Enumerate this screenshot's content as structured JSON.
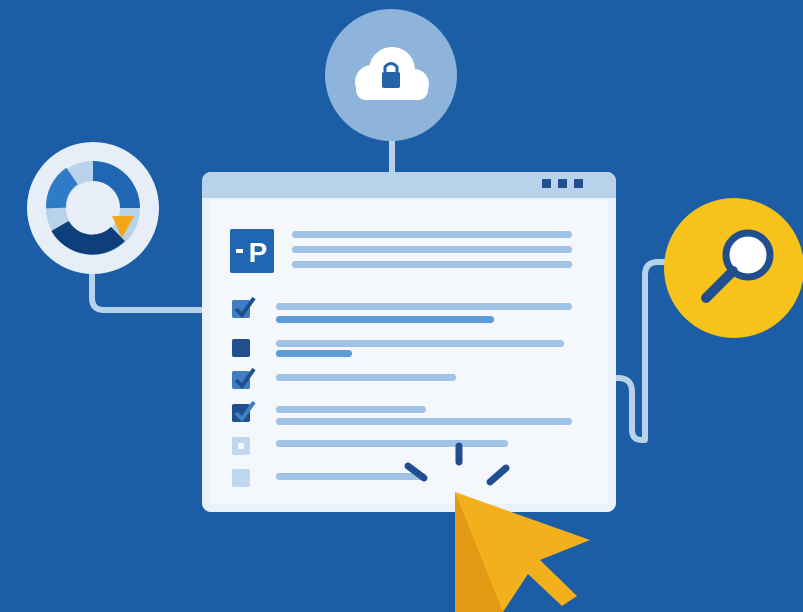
{
  "colors": {
    "background": "#1b5ea5",
    "window_frame": "#e9f1fb",
    "window_body": "#f4f8fd",
    "titlebar": "#b9d2ec",
    "line_light": "#9fc2e6",
    "line_mid": "#5f9bd6",
    "logo_tile": "#1f66b3",
    "checkbox": "#3f7ec3",
    "checkbox_empty": "#bfd7ef",
    "cloud_badge": "#8fb4dc",
    "chart_badge": "#e7eef8",
    "search_badge": "#f7c21a",
    "cursor": "#f2b01c",
    "connector": "#b9d2ec"
  },
  "icons": {
    "cloud_lock": "cloud-lock-icon",
    "donut_chart": "donut-chart-icon",
    "magnifier": "magnifier-icon",
    "cursor": "mouse-pointer-icon",
    "logo": "p-logo-icon"
  },
  "window": {
    "logo_letter": "P",
    "checklist": [
      {
        "state": "checked"
      },
      {
        "state": "filled"
      },
      {
        "state": "checked"
      },
      {
        "state": "checked"
      },
      {
        "state": "empty"
      },
      {
        "state": "empty-filled"
      }
    ]
  }
}
